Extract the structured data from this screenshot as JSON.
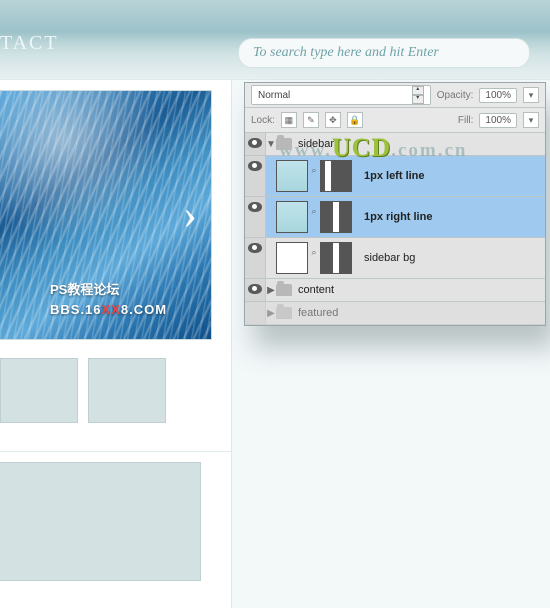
{
  "nav": {
    "contact_label": "TACT"
  },
  "search": {
    "placeholder": "To search type here and hit Enter"
  },
  "hero": {
    "arrow": "›",
    "caption_line1": "PS教程论坛",
    "caption_line2_a": "BBS.16",
    "caption_line2_red": "XX",
    "caption_line2_b": "8.COM"
  },
  "panel": {
    "blend_mode": "Normal",
    "opacity_label": "Opacity:",
    "opacity_value": "100%",
    "lock_label": "Lock:",
    "fill_label": "Fill:",
    "fill_value": "100%"
  },
  "layers": [
    {
      "type": "group",
      "name": "sidebar",
      "open": true,
      "visible": true,
      "level": 0,
      "selected": false
    },
    {
      "type": "layer",
      "name": "1px left line",
      "visible": true,
      "level": 1,
      "selected": true,
      "thumb": "bg1",
      "mask": "mask2"
    },
    {
      "type": "layer",
      "name": "1px right line",
      "visible": true,
      "level": 1,
      "selected": true,
      "thumb": "bg1",
      "mask": "mask"
    },
    {
      "type": "layer",
      "name": "sidebar bg",
      "visible": true,
      "level": 1,
      "selected": false,
      "thumb": "bg2",
      "mask": "mask"
    },
    {
      "type": "group",
      "name": "content",
      "open": false,
      "visible": true,
      "level": 0,
      "selected": false
    },
    {
      "type": "group",
      "name": "featured",
      "open": false,
      "visible": false,
      "level": 0,
      "selected": false
    }
  ],
  "watermark": {
    "www": "www.",
    "ucd": "UCD",
    "com": ".com.cn"
  }
}
